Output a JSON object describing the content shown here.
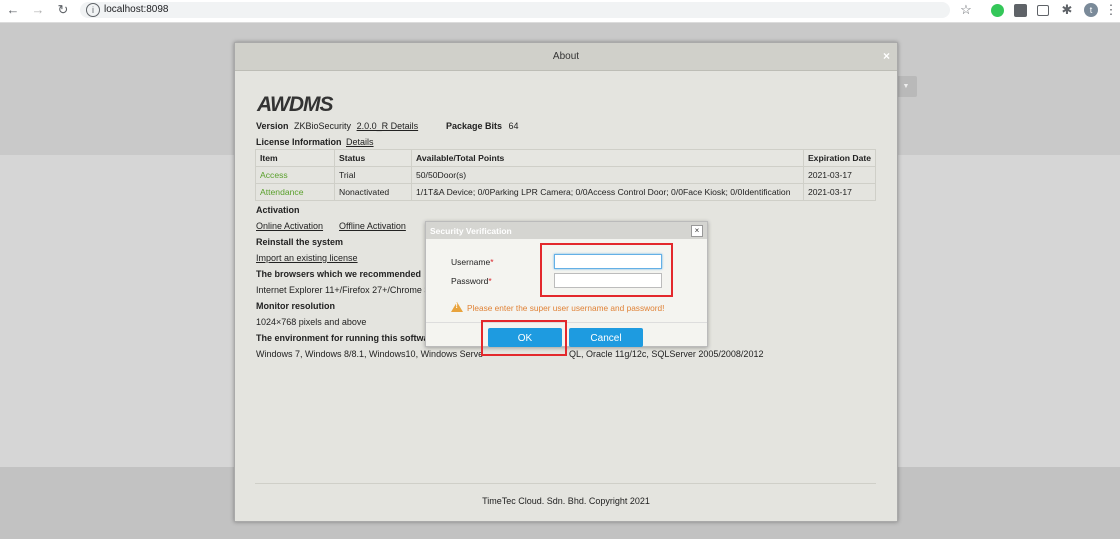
{
  "browser": {
    "url": "localhost:8098",
    "profile_initial": "t"
  },
  "about": {
    "title": "About",
    "close_glyph": "×",
    "logo": "AWDMS",
    "version_label": "Version",
    "version_value": "ZKBioSecurity",
    "version_link": "2.0.0_R Details",
    "package_bits_label": "Package Bits",
    "package_bits_value": "64",
    "license_label": "License Information",
    "license_details": "Details",
    "table": {
      "headers": [
        "Item",
        "Status",
        "Available/Total Points",
        "Expiration Date"
      ],
      "rows": [
        [
          "Access",
          "Trial",
          "50/50Door(s)",
          "2021-03-17"
        ],
        [
          "Attendance",
          "Nonactivated",
          "1/1T&A Device; 0/0Parking LPR Camera; 0/0Access Control Door; 0/0Face Kiosk; 0/0Identification",
          "2021-03-17"
        ]
      ]
    },
    "activation_heading": "Activation",
    "online_activation": "Online Activation",
    "offline_activation": "Offline Activation",
    "reinstall_heading": "Reinstall the system",
    "import_license": "Import an existing license",
    "browsers_heading": "The browsers which we recommended",
    "browsers_text": "Internet Explorer 11+/Firefox 27+/Chrome 3",
    "monitor_heading": "Monitor resolution",
    "monitor_text": "1024×768 pixels and above",
    "env_heading": "The environment for running this softwa",
    "env_text_left": "Windows 7, Windows 8/8.1, Windows10, Windows Serve",
    "env_text_right": "QL, Oracle 11g/12c, SQLServer 2005/2008/2012",
    "footer": "TimeTec Cloud. Sdn. Bhd.   Copyright 2021"
  },
  "security": {
    "title": "Security Verification",
    "close_glyph": "×",
    "username_label": "Username",
    "password_label": "Password",
    "required_mark": "*",
    "username_value": "",
    "password_value": "",
    "warning_icon_glyph": "!",
    "warning": "Please enter the super user username and password!",
    "ok_label": "OK",
    "cancel_label": "Cancel"
  },
  "colors": {
    "accent": "#1e9be0",
    "highlight": "#e3282c",
    "warning": "#e08236",
    "link_green": "#5aa02c"
  }
}
